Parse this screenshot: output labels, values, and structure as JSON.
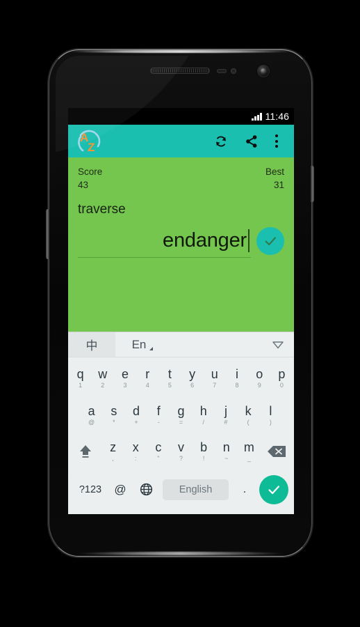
{
  "status_bar": {
    "time": "11:46",
    "signal_icon": "signal-bars-icon"
  },
  "app_bar": {
    "logo_letters": {
      "a": "A",
      "z": "Z"
    },
    "logo_name": "app-logo-az",
    "actions": [
      {
        "name": "refresh-button",
        "icon": "refresh-icon"
      },
      {
        "name": "share-button",
        "icon": "share-icon"
      },
      {
        "name": "overflow-menu-button",
        "icon": "three-dots-vertical-icon"
      }
    ]
  },
  "game": {
    "score_label": "Score",
    "score_value": "43",
    "best_label": "Best",
    "best_value": "31",
    "prompt_word": "traverse",
    "answer_value": "endanger",
    "submit_icon": "check-icon"
  },
  "keyboard": {
    "toolbar": {
      "chinese_tab": "中",
      "english_tab": "En",
      "collapse_icon": "collapse-keyboard-icon"
    },
    "row1": [
      {
        "main": "q",
        "sub": "1"
      },
      {
        "main": "w",
        "sub": "2"
      },
      {
        "main": "e",
        "sub": "3"
      },
      {
        "main": "r",
        "sub": "4"
      },
      {
        "main": "t",
        "sub": "5"
      },
      {
        "main": "y",
        "sub": "6"
      },
      {
        "main": "u",
        "sub": "7"
      },
      {
        "main": "i",
        "sub": "8"
      },
      {
        "main": "o",
        "sub": "9"
      },
      {
        "main": "p",
        "sub": "0"
      }
    ],
    "row2": [
      {
        "main": "a",
        "sub": "@"
      },
      {
        "main": "s",
        "sub": "*"
      },
      {
        "main": "d",
        "sub": "+"
      },
      {
        "main": "f",
        "sub": "-"
      },
      {
        "main": "g",
        "sub": "="
      },
      {
        "main": "h",
        "sub": "/"
      },
      {
        "main": "j",
        "sub": "#"
      },
      {
        "main": "k",
        "sub": "("
      },
      {
        "main": "l",
        "sub": ")"
      }
    ],
    "row3": [
      {
        "main": "z",
        "sub": ","
      },
      {
        "main": "x",
        "sub": ":"
      },
      {
        "main": "c",
        "sub": "\""
      },
      {
        "main": "v",
        "sub": "?"
      },
      {
        "main": "b",
        "sub": "!"
      },
      {
        "main": "n",
        "sub": "~"
      },
      {
        "main": "m",
        "sub": "_"
      }
    ],
    "shift_icon": "shift-arrow-icon",
    "backspace_icon": "backspace-icon",
    "bottom": {
      "symbols_key": "?123",
      "at_key": "@",
      "globe_icon": "globe-language-icon",
      "space_key": "English",
      "period_key": ".",
      "enter_icon": "check-icon"
    }
  },
  "colors": {
    "app_bar_teal": "#1ABFB0",
    "game_green": "#74C64F",
    "keyboard_bg": "#ECEFEF",
    "enter_teal": "#0DBC96",
    "logo_orange": "#F79433",
    "logo_arc_blue": "#9FD8EC"
  }
}
